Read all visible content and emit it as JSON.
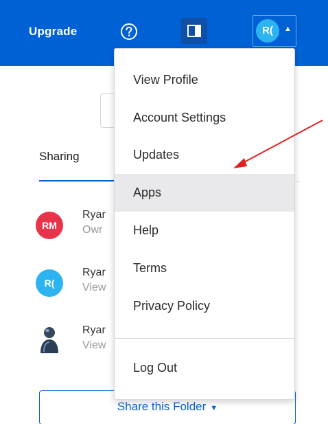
{
  "header": {
    "upgrade_label": "Upgrade",
    "help_icon": "question-circle-icon",
    "panel_icon": "sidebar-panel-icon",
    "avatar_initials": "R(",
    "avatar_color": "#2bb4f0",
    "brand_color": "#0061d5"
  },
  "sharing": {
    "tab_label": "Sharing",
    "collaborators": [
      {
        "initials": "RM",
        "name": "Ryar",
        "role": "Owr",
        "color": "#e8344a"
      },
      {
        "initials": "R(",
        "name": "Ryar",
        "role": "View",
        "color": "#2bb4f0"
      },
      {
        "initials": "",
        "name": "Ryar",
        "role": "View",
        "icon": "person-icon"
      }
    ],
    "share_button_label": "Share this Folder"
  },
  "menu": {
    "items": [
      {
        "label": "View Profile"
      },
      {
        "label": "Account Settings"
      },
      {
        "label": "Updates"
      },
      {
        "label": "Apps",
        "highlighted": true
      },
      {
        "label": "Help"
      },
      {
        "label": "Terms"
      },
      {
        "label": "Privacy Policy"
      },
      {
        "label": "Log Out"
      }
    ]
  },
  "annotation": {
    "type": "arrow",
    "color": "#e02020",
    "points_to": "Apps"
  }
}
